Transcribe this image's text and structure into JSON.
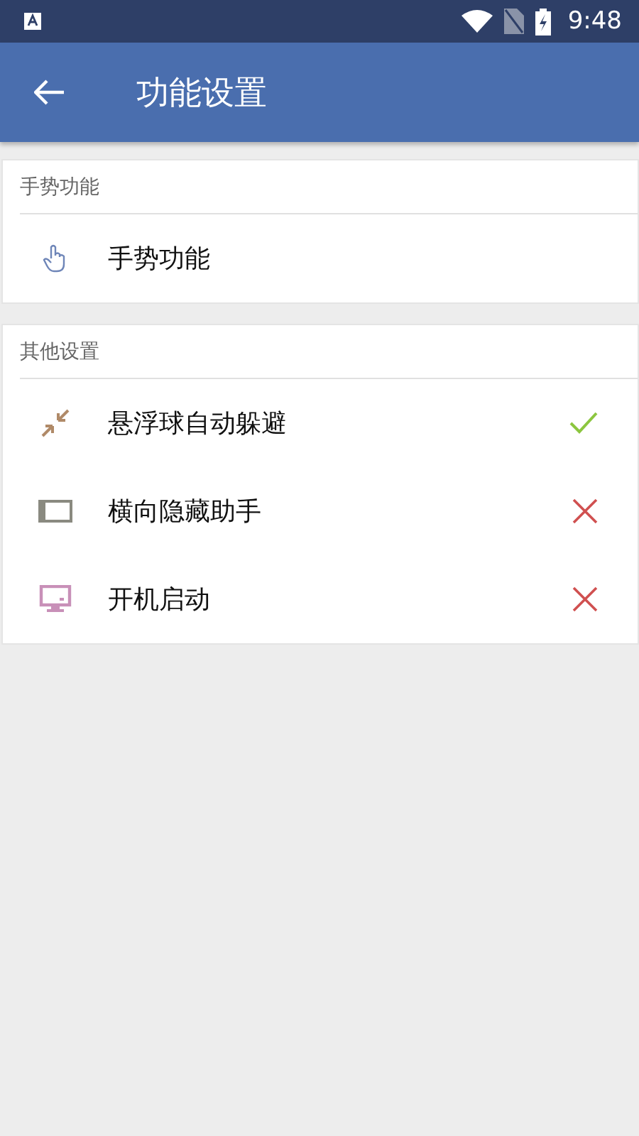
{
  "status_bar": {
    "time": "9:48"
  },
  "app_bar": {
    "title": "功能设置"
  },
  "sections": [
    {
      "header": "手势功能",
      "items": [
        {
          "label": "手势功能",
          "kind": "link"
        }
      ]
    },
    {
      "header": "其他设置",
      "items": [
        {
          "label": "悬浮球自动躲避",
          "kind": "toggle",
          "on": true
        },
        {
          "label": "横向隐藏助手",
          "kind": "toggle",
          "on": false
        },
        {
          "label": "开机启动",
          "kind": "toggle",
          "on": false
        }
      ]
    }
  ]
}
